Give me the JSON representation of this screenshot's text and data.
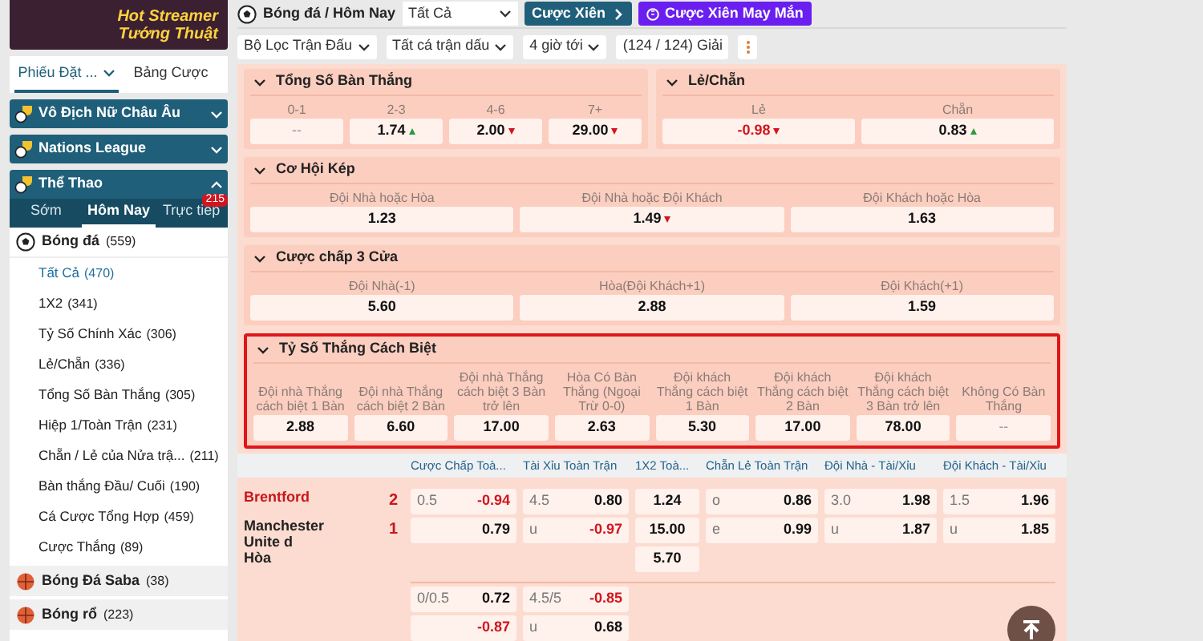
{
  "sidebar": {
    "banner_title": "Hot Streamer Tướng Thuật",
    "tabs": [
      {
        "label": "Phiếu Đặt ...",
        "selected": true
      },
      {
        "label": "Bảng Cược",
        "selected": false
      }
    ],
    "sections": [
      {
        "title": "Vô Địch Nữ Châu Âu",
        "expanded": false
      },
      {
        "title": "Nations League",
        "expanded": false
      },
      {
        "title": "Thể Thao",
        "expanded": true
      }
    ],
    "sport_tabs": [
      {
        "label": "Sớm",
        "selected": false
      },
      {
        "label": "Hôm Nay",
        "selected": true
      },
      {
        "label": "Trực tiếp",
        "selected": false,
        "badge": "215"
      }
    ],
    "sports": [
      {
        "name": "Bóng đá",
        "count": "(559)",
        "children": [
          {
            "label": "Tất Cả",
            "count": "(470)",
            "selected": true
          },
          {
            "label": "1X2",
            "count": "(341)",
            "selected": false
          },
          {
            "label": "Tỷ Số Chính Xác",
            "count": "(306)",
            "selected": false
          },
          {
            "label": "Lẻ/Chẵn",
            "count": "(336)",
            "selected": false
          },
          {
            "label": "Tổng Số Bàn Thắng",
            "count": "(305)",
            "selected": false
          },
          {
            "label": "Hiệp 1/Toàn Trận",
            "count": "(231)",
            "selected": false
          },
          {
            "label": "Chẵn / Lẻ của Nửa trậ...",
            "count": "(211)",
            "selected": false
          },
          {
            "label": "Bàn thắng Đầu/ Cuối",
            "count": "(190)",
            "selected": false
          },
          {
            "label": "Cá Cược Tổng Hợp",
            "count": "(459)",
            "selected": false
          },
          {
            "label": "Cược Thắng",
            "count": "(89)",
            "selected": false
          }
        ]
      },
      {
        "name": "Bóng Đá Saba",
        "count": "(38)"
      },
      {
        "name": "Bóng rổ",
        "count": "(223)"
      }
    ]
  },
  "header": {
    "breadcrumb": "Bóng đá / Hôm Nay",
    "select": "Tất Cả",
    "parlay_button": "Cược Xiên",
    "lucky_button": "Cược Xiên May Mắn"
  },
  "filters": [
    "Bộ Lọc Trận Đấu",
    "Tất cá trận dấu",
    "4 giờ tới",
    "(124 / 124) Giải"
  ],
  "market_rows": [
    [
      {
        "title": "Tổng Số Bàn Thắng",
        "highlighted": false,
        "options": [
          {
            "label": "0-1",
            "odds": "--",
            "rising": false,
            "falling": false,
            "negative": false
          },
          {
            "label": "2-3",
            "odds": "1.74",
            "rising": true,
            "falling": false,
            "negative": false
          },
          {
            "label": "4-6",
            "odds": "2.00",
            "rising": false,
            "falling": true,
            "negative": false
          },
          {
            "label": "7+",
            "odds": "29.00",
            "rising": false,
            "falling": true,
            "negative": false
          }
        ]
      },
      {
        "title": "Lẻ/Chẵn",
        "highlighted": false,
        "options": [
          {
            "label": "Lẻ",
            "odds": "-0.98",
            "rising": false,
            "falling": true,
            "negative": true
          },
          {
            "label": "Chẵn",
            "odds": "0.83",
            "rising": true,
            "falling": false,
            "negative": false
          }
        ]
      }
    ],
    [
      {
        "title": "Cơ Hội Kép",
        "highlighted": false,
        "options": [
          {
            "label": "Đội Nhà hoặc Hòa",
            "odds": "1.23",
            "rising": false,
            "falling": false,
            "negative": false
          },
          {
            "label": "Đội Nhà hoặc Đội Khách",
            "odds": "1.49",
            "rising": false,
            "falling": true,
            "negative": false
          },
          {
            "label": "Đội Khách hoặc Hòa",
            "odds": "1.63",
            "rising": false,
            "falling": false,
            "negative": false
          }
        ]
      }
    ],
    [
      {
        "title": "Cược chấp 3 Cửa",
        "highlighted": false,
        "options": [
          {
            "label": "Đội Nhà(-1)",
            "odds": "5.60",
            "rising": false,
            "falling": false,
            "negative": false
          },
          {
            "label": "Hòa(Đội Khách+1)",
            "odds": "2.88",
            "rising": false,
            "falling": false,
            "negative": false
          },
          {
            "label": "Đội Khách(+1)",
            "odds": "1.59",
            "rising": false,
            "falling": false,
            "negative": false
          }
        ]
      }
    ],
    [
      {
        "title": "Tỷ Số Thắng Cách Biệt",
        "highlighted": true,
        "options": [
          {
            "label": "Đội nhà Thắng cách biệt 1 Bàn",
            "odds": "2.88",
            "rising": false,
            "falling": false,
            "negative": false
          },
          {
            "label": "Đội nhà Thắng cách biệt 2 Bàn",
            "odds": "6.60",
            "rising": false,
            "falling": false,
            "negative": false
          },
          {
            "label": "Đội nhà Thắng cách biệt 3 Bàn trở lên",
            "odds": "17.00",
            "rising": false,
            "falling": false,
            "negative": false
          },
          {
            "label": "Hòa Có Bàn Thắng (Ngoại Trừ 0-0)",
            "odds": "2.63",
            "rising": false,
            "falling": false,
            "negative": false
          },
          {
            "label": "Đội khách Thắng cách biệt 1 Bàn",
            "odds": "5.30",
            "rising": false,
            "falling": false,
            "negative": false
          },
          {
            "label": "Đội khách Thắng cách biệt 2 Bàn",
            "odds": "17.00",
            "rising": false,
            "falling": false,
            "negative": false
          },
          {
            "label": "Đội khách Thắng cách biệt 3 Bàn trở lên",
            "odds": "78.00",
            "rising": false,
            "falling": false,
            "negative": false
          },
          {
            "label": "Không Có Bàn Thắng",
            "odds": "--",
            "rising": false,
            "falling": false,
            "negative": false
          }
        ]
      }
    ]
  ],
  "match_table": {
    "columns": [
      "Cược Chấp Toà...",
      "Tài Xỉu Toàn Trận",
      "1X2 Toà...",
      "Chẵn Lẻ Toàn Trận",
      "Đội Nhà - Tài/Xỉu",
      "Đội Khách - Tài/Xỉu"
    ],
    "teams": [
      {
        "name": "Brentford",
        "score": "2",
        "favorite": true
      },
      {
        "name": "Manchester Unite d",
        "score": "1",
        "favorite": false
      },
      {
        "name": "Hòa",
        "favorite": false
      }
    ],
    "lines": [
      [
        [
          {
            "line": "0.5",
            "odds": "-0.94",
            "negative": true
          },
          {
            "odds": "0.79",
            "negative": false
          }
        ],
        [
          {
            "line": "4.5",
            "odds": "0.80",
            "negative": false
          },
          {
            "line": "u",
            "odds": "-0.97",
            "negative": true
          }
        ],
        [
          {
            "odds": "1.24",
            "negative": false
          },
          {
            "odds": "15.00",
            "negative": false
          },
          {
            "odds": "5.70",
            "negative": false
          }
        ],
        [
          {
            "line": "o",
            "odds": "0.86",
            "negative": false
          },
          {
            "line": "e",
            "odds": "0.99",
            "negative": false
          }
        ],
        [
          {
            "line": "3.0",
            "odds": "1.98",
            "negative": false
          },
          {
            "line": "u",
            "odds": "1.87",
            "negative": false
          }
        ],
        [
          {
            "line": "1.5",
            "odds": "1.96",
            "negative": false
          },
          {
            "line": "u",
            "odds": "1.85",
            "negative": false
          }
        ]
      ],
      [
        [
          {
            "line": "0/0.5",
            "odds": "0.72",
            "negative": false
          },
          {
            "odds": "-0.87",
            "negative": true
          }
        ],
        [
          {
            "line": "4.5/5",
            "odds": "-0.85",
            "negative": true
          },
          {
            "line": "u",
            "odds": "0.68",
            "negative": false
          }
        ]
      ]
    ]
  }
}
